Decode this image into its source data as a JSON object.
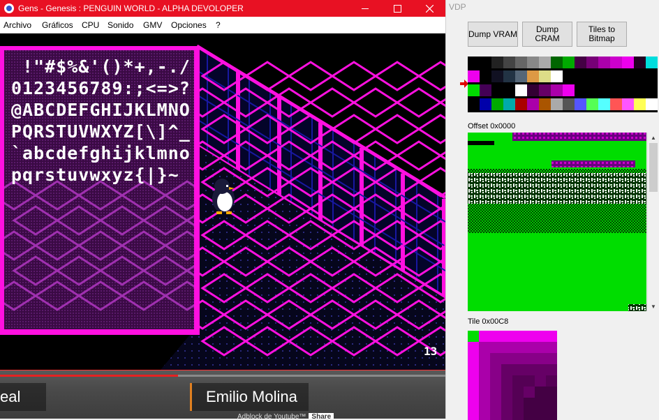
{
  "gens_window": {
    "title": "Gens - Genesis : PENGUIN WORLD - ALPHA DEVOLOPER",
    "controls": {
      "minimize": "minimize",
      "maximize": "maximize",
      "close": "close"
    },
    "menu": [
      "Archivo",
      "Gráficos",
      "CPU",
      "Sonido",
      "GMV",
      "Opciones",
      "?"
    ]
  },
  "game": {
    "font_lines": [
      " !\"#$%&'()*+,-./",
      "0123456789:;<=>?",
      "@ABCDEFGHIJKLMNO",
      "PQRSTUVWXYZ[\\]^_",
      "`abcdefghijklmno",
      "pqrstuvwxyz{|}~"
    ],
    "counter": "13",
    "colors": {
      "magenta": "#ff10e0",
      "dark_magenta": "#7a1080",
      "blue_grid": "#1818a0",
      "floor": "#0a0a2a"
    }
  },
  "youtube_bar": {
    "chip_left": "eal",
    "chip_right": "Emilio Molina",
    "ad_text": "Adblock de Youtube™",
    "share_label": "Share",
    "progress": 0.4
  },
  "vdp_window": {
    "title": "VDP",
    "buttons": {
      "dump_vram": "Dump VRAM",
      "dump_cram": "Dump CRAM",
      "tiles_to_bitmap_1": "Tiles to",
      "tiles_to_bitmap_2": "Bitmap"
    },
    "palette_rows": [
      [
        "#000000",
        "#000000",
        "#222222",
        "#444444",
        "#666666",
        "#888888",
        "#aaaaaa",
        "#006600",
        "#00aa00",
        "#440044",
        "#770077",
        "#aa00aa",
        "#cc00cc",
        "#ee00ee",
        "#220022",
        "#00dddd"
      ],
      [
        "#ee00ee",
        "#000000",
        "#111122",
        "#223344",
        "#556677",
        "#dd9944",
        "#dddd88",
        "#ffffff",
        "#000000",
        "#000000",
        "#000000",
        "#000000",
        "#000000",
        "#000000",
        "#000000",
        "#000000"
      ],
      [
        "#00dd00",
        "#440055",
        "#000000",
        "#000000",
        "#ffffff",
        "#330033",
        "#660066",
        "#aa00aa",
        "#ee00ee",
        "#000000",
        "#000000",
        "#000000",
        "#000000",
        "#000000",
        "#000000",
        "#000000"
      ],
      [
        "#000000",
        "#0000aa",
        "#00aa00",
        "#00aaaa",
        "#aa0000",
        "#aa00aa",
        "#aa5500",
        "#aaaaaa",
        "#555555",
        "#5555ff",
        "#55ff55",
        "#55ffff",
        "#ff5555",
        "#ff55ff",
        "#ffff55",
        "#ffffff"
      ]
    ],
    "offset_label": "Offset 0x0000",
    "tile_label": "Tile 0x00C8"
  }
}
